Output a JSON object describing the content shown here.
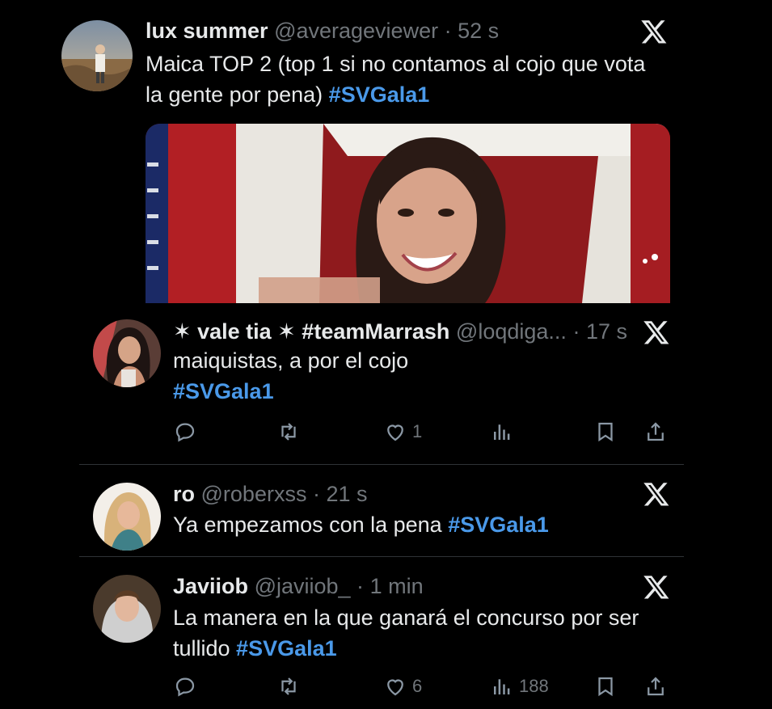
{
  "tweets": [
    {
      "name": "lux summer",
      "handle": "@averageviewer",
      "time": "52 s",
      "text": "Maica TOP 2 (top 1 si no contamos al cojo que vota la gente por pena) ",
      "hashtag": "#SVGala1"
    },
    {
      "name": "✶ vale tia ✶ #teamMarrash",
      "handle": "@loqdiga...",
      "time": "17 s",
      "text": "maiquistas, a por el cojo",
      "hashtag": "#SVGala1",
      "likes": "1",
      "views": ""
    },
    {
      "name": "ro",
      "handle": "@roberxss",
      "time": "21 s",
      "text": "Ya empezamos con la pena ",
      "hashtag": "#SVGala1"
    },
    {
      "name": "Javiiob",
      "handle": "@javiiob_",
      "time": "1 min",
      "text": "La manera en la que ganará el concurso por ser tullido  ",
      "hashtag": "#SVGala1",
      "likes": "6",
      "views": "188"
    }
  ],
  "separator": "·",
  "icons": [
    "x-logo-icon",
    "reply-icon",
    "retweet-icon",
    "like-icon",
    "views-icon",
    "bookmark-icon",
    "share-icon"
  ],
  "colors": {
    "background": "#000000",
    "text": "#e7e9ea",
    "muted": "#71767b",
    "hashtag": "#4a99e9",
    "divider": "#2f3336"
  }
}
